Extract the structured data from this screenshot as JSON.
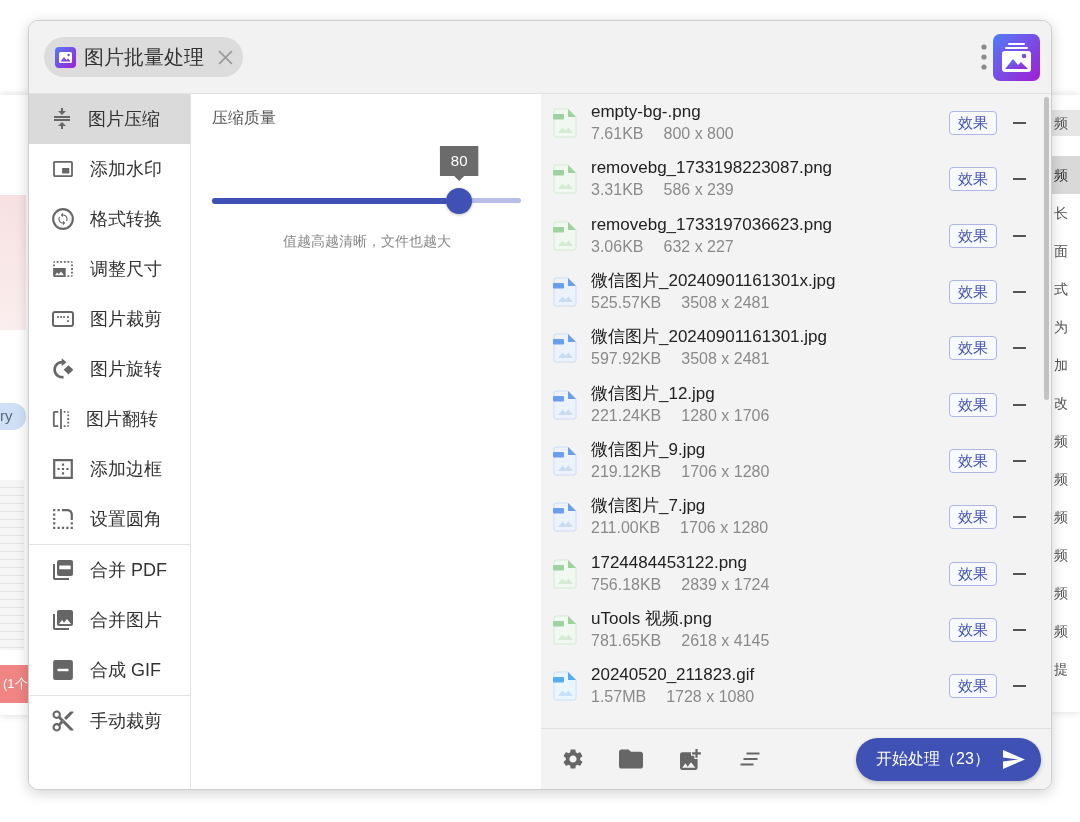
{
  "background": {
    "left_window": {
      "tag": "ry",
      "button": "(1个"
    },
    "right_window": {
      "title": "频",
      "items": [
        {
          "label": "频",
          "selected": true
        },
        {
          "label": "长",
          "selected": false
        },
        {
          "label": "面",
          "selected": false
        },
        {
          "label": "式",
          "selected": false
        },
        {
          "label": "为",
          "selected": false
        },
        {
          "label": "加",
          "selected": false
        },
        {
          "label": "改",
          "selected": false
        },
        {
          "label": "频",
          "selected": false
        },
        {
          "label": "频",
          "selected": false
        },
        {
          "label": "频",
          "selected": false
        },
        {
          "label": "频",
          "selected": false
        },
        {
          "label": "频",
          "selected": false
        },
        {
          "label": "频",
          "selected": false
        },
        {
          "label": "提",
          "selected": false
        }
      ]
    }
  },
  "window": {
    "tab": {
      "title": "图片批量处理"
    }
  },
  "sidebar": {
    "groups": [
      [
        {
          "label": "图片压缩",
          "selected": true
        },
        {
          "label": "添加水印",
          "selected": false
        },
        {
          "label": "格式转换",
          "selected": false
        },
        {
          "label": "调整尺寸",
          "selected": false
        },
        {
          "label": "图片裁剪",
          "selected": false
        },
        {
          "label": "图片旋转",
          "selected": false
        },
        {
          "label": "图片翻转",
          "selected": false
        },
        {
          "label": "添加边框",
          "selected": false
        },
        {
          "label": "设置圆角",
          "selected": false
        }
      ],
      [
        {
          "label": "合并 PDF",
          "selected": false
        },
        {
          "label": "合并图片",
          "selected": false
        },
        {
          "label": "合成 GIF",
          "selected": false
        }
      ],
      [
        {
          "label": "手动裁剪",
          "selected": false
        }
      ]
    ]
  },
  "compression": {
    "label": "压缩质量",
    "slider": {
      "level": 0.8,
      "value": "80"
    },
    "hint": "值越高越清晰，文件也越大"
  },
  "files": [
    {
      "name": "empty-bg-.png",
      "kind": "png",
      "size": "7.61KB",
      "dimensions": "800 x 800",
      "action": "效果"
    },
    {
      "name": "removebg_1733198223087.png",
      "kind": "png",
      "size": "3.31KB",
      "dimensions": "586 x 239",
      "action": "效果"
    },
    {
      "name": "removebg_1733197036623.png",
      "kind": "png",
      "size": "3.06KB",
      "dimensions": "632 x 227",
      "action": "效果"
    },
    {
      "name": "微信图片_20240901161301x.jpg",
      "kind": "jpg",
      "size": "525.57KB",
      "dimensions": "3508 x 2481",
      "action": "效果"
    },
    {
      "name": "微信图片_20240901161301.jpg",
      "kind": "jpg",
      "size": "597.92KB",
      "dimensions": "3508 x 2481",
      "action": "效果"
    },
    {
      "name": "微信图片_12.jpg",
      "kind": "jpg",
      "size": "221.24KB",
      "dimensions": "1280 x 1706",
      "action": "效果"
    },
    {
      "name": "微信图片_9.jpg",
      "kind": "jpg",
      "size": "219.12KB",
      "dimensions": "1706 x 1280",
      "action": "效果"
    },
    {
      "name": "微信图片_7.jpg",
      "kind": "jpg",
      "size": "211.00KB",
      "dimensions": "1706 x 1280",
      "action": "效果"
    },
    {
      "name": "1724484453122.png",
      "kind": "png",
      "size": "756.18KB",
      "dimensions": "2839 x 1724",
      "action": "效果"
    },
    {
      "name": "uTools 视频.png",
      "kind": "png",
      "size": "781.65KB",
      "dimensions": "2618 x 4145",
      "action": "效果"
    },
    {
      "name": "20240520_211823.gif",
      "kind": "gif",
      "size": "1.57MB",
      "dimensions": "1728 x 1080",
      "action": "效果"
    }
  ],
  "footer": {
    "start_button": "开始处理（23）"
  }
}
